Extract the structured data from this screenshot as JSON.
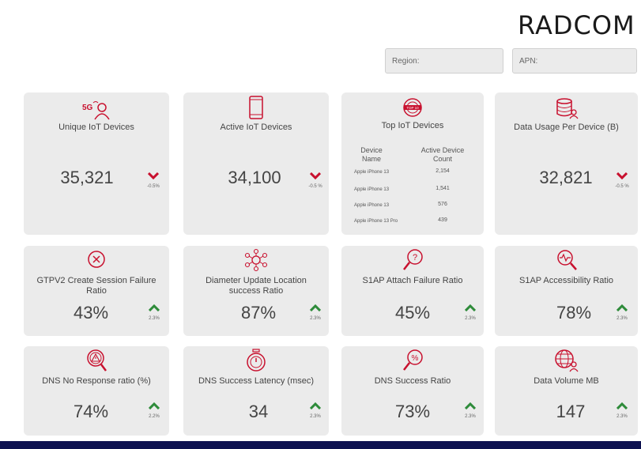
{
  "brand": {
    "logo": "RADCOM"
  },
  "filters": {
    "region_label": "Region:",
    "apn_label": "APN:"
  },
  "row1": [
    {
      "title": "Unique IoT Devices",
      "value": "35,321",
      "trend": "down",
      "change": "-0.5%",
      "icon": "5g-user-icon"
    },
    {
      "title": "Active IoT Devices",
      "value": "34,100",
      "trend": "down",
      "change": "-0.5 %",
      "icon": "smartphone-icon"
    },
    {
      "title": "Data Usage Per Device (B)",
      "value": "32,821",
      "trend": "down",
      "change": "-0.5 %",
      "icon": "database-user-icon"
    }
  ],
  "top_devices": {
    "title": "Top IoT Devices",
    "icon": "top10-badge-icon",
    "col_name": "Device Name",
    "col_count": "Active Device Count",
    "rows": [
      {
        "name": "Apple iPhone 13",
        "count": "2,154"
      },
      {
        "name": "Apple iPhone 13",
        "count": "1,541"
      },
      {
        "name": "Apple iPhone 13",
        "count": "576"
      },
      {
        "name": "Apple iPhone 13 Pro",
        "count": "439"
      }
    ]
  },
  "row2": [
    {
      "title": "GTPV2 Create Session Failure Ratio",
      "value": "43%",
      "trend": "up",
      "change": "2.3%",
      "icon": "x-circle-icon"
    },
    {
      "title": "Diameter Update Location success Ratio",
      "value": "87%",
      "trend": "up",
      "change": "2.3%",
      "icon": "network-nodes-icon"
    },
    {
      "title": "S1AP Attach Failure Ratio",
      "value": "45%",
      "trend": "up",
      "change": "2.3%",
      "icon": "magnifier-question-icon"
    },
    {
      "title": "S1AP Accessibility Ratio",
      "value": "78%",
      "trend": "up",
      "change": "2.3%",
      "icon": "magnifier-pulse-icon"
    }
  ],
  "row3": [
    {
      "title": "DNS No Response ratio (%)",
      "value": "74%",
      "trend": "up",
      "change": "2.2%",
      "icon": "magnifier-warning-icon"
    },
    {
      "title": "DNS Success Latency (msec)",
      "value": "34",
      "trend": "up",
      "change": "2.3%",
      "icon": "stopwatch-icon"
    },
    {
      "title": "DNS Success Ratio",
      "value": "73%",
      "trend": "up",
      "change": "2.3%",
      "icon": "magnifier-percent-icon"
    },
    {
      "title": "Data Volume MB",
      "value": "147",
      "trend": "up",
      "change": "2.3%",
      "icon": "globe-user-icon"
    }
  ],
  "colors": {
    "red": "#c8102e",
    "green": "#2e8b3a",
    "card": "#ebebeb",
    "footer": "#0d1150"
  }
}
